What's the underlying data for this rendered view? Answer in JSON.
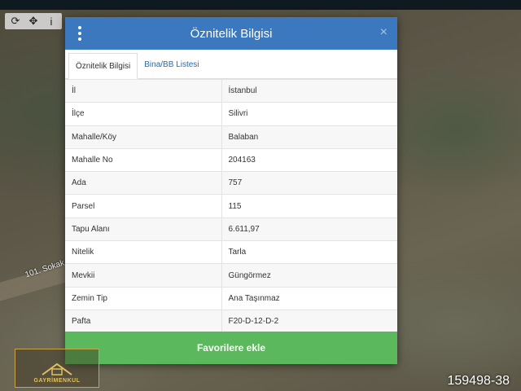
{
  "modal": {
    "title": "Öznitelik Bilgisi",
    "close_glyph": "×",
    "tabs": [
      {
        "label": "Öznitelik Bilgisi"
      },
      {
        "label": "Bina/BB Listesi"
      }
    ],
    "rows": [
      {
        "key": "İl",
        "value": "İstanbul"
      },
      {
        "key": "İlçe",
        "value": "Silivri"
      },
      {
        "key": "Mahalle/Köy",
        "value": "Balaban"
      },
      {
        "key": "Mahalle No",
        "value": "204163"
      },
      {
        "key": "Ada",
        "value": "757"
      },
      {
        "key": "Parsel",
        "value": "115"
      },
      {
        "key": "Tapu Alanı",
        "value": "6.611,97"
      },
      {
        "key": "Nitelik",
        "value": "Tarla"
      },
      {
        "key": "Mevkii",
        "value": "Güngörmez"
      },
      {
        "key": "Zemin Tip",
        "value": "Ana Taşınmaz"
      },
      {
        "key": "Pafta",
        "value": "F20-D-12-D-2"
      }
    ],
    "button_label": "Favorilere ekle"
  },
  "toolbar": {
    "icons": [
      "refresh-icon",
      "crosshair-icon",
      "info-icon"
    ],
    "glyphs": [
      "⟳",
      "✥",
      "i"
    ]
  },
  "map": {
    "road_label": "101. Sokak",
    "reference_number": "159498-38",
    "logo_text": "GAYRİMENKUL"
  },
  "colors": {
    "header": "#3b78be",
    "button": "#5cb85c",
    "tab_link": "#2a6aa8"
  }
}
